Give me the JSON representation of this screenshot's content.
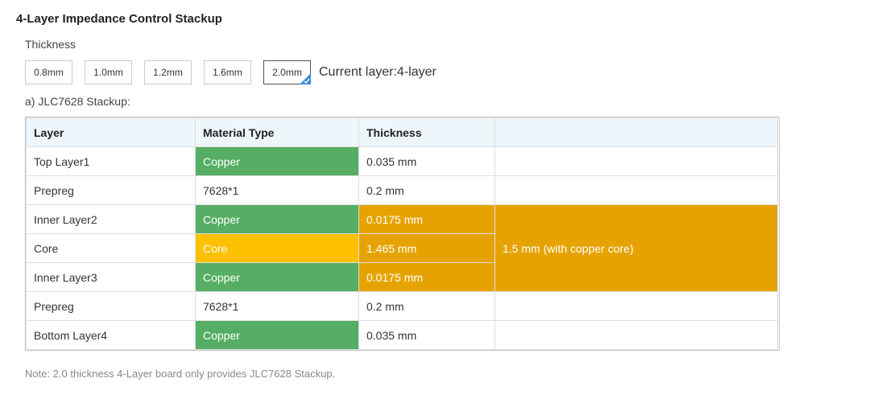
{
  "title": "4-Layer Impedance Control Stackup",
  "thickness": {
    "label": "Thickness",
    "options": [
      "0.8mm",
      "1.0mm",
      "1.2mm",
      "1.6mm",
      "2.0mm"
    ],
    "selected": "2.0mm",
    "current_layer": "Current layer:4-layer"
  },
  "stackup_label": "a) JLC7628 Stackup:",
  "table": {
    "headers": [
      "Layer",
      "Material Type",
      "Thickness",
      ""
    ],
    "rows": [
      {
        "layer": "Top Layer1",
        "material": "Copper",
        "thickness": "0.035 mm"
      },
      {
        "layer": "Prepreg",
        "material": "7628*1",
        "thickness": "0.2 mm"
      },
      {
        "layer": "Inner Layer2",
        "material": "Copper",
        "thickness": "0.0175 mm"
      },
      {
        "layer": "Core",
        "material": "Core",
        "thickness": "1.465 mm"
      },
      {
        "layer": "Inner Layer3",
        "material": "Copper",
        "thickness": "0.0175 mm"
      },
      {
        "layer": "Prepreg",
        "material": "7628*1",
        "thickness": "0.2 mm"
      },
      {
        "layer": "Bottom Layer4",
        "material": "Copper",
        "thickness": "0.035 mm"
      }
    ],
    "core_total": "1.5 mm (with copper core)"
  },
  "note": "Note: 2.0 thickness 4-Layer board only provides JLC7628 Stackup.",
  "colors": {
    "copper": "#55ae63",
    "core": "#fec100",
    "inner_block": "#e6a300",
    "header_bg": "#eef6fb",
    "selected_check": "#3d8fd8"
  }
}
